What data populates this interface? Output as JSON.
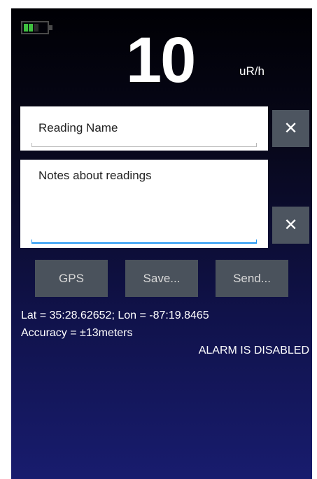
{
  "status_bar": {
    "battery_icon": "battery-icon",
    "battery_color": "#3fbf3f"
  },
  "reading": {
    "value": "10",
    "unit": "uR/h"
  },
  "form": {
    "reading_name_placeholder": "Reading Name",
    "notes_placeholder": "Notes about readings",
    "clear_icon": "✕"
  },
  "actions": {
    "gps_label": "GPS",
    "save_label": "Save...",
    "send_label": "Send..."
  },
  "location": {
    "latlon_text": "Lat = 35:28.62652; Lon = -87:19.8465",
    "accuracy_text": "Accuracy = ±13meters"
  },
  "alarm": {
    "status_text": "ALARM IS DISABLED"
  }
}
